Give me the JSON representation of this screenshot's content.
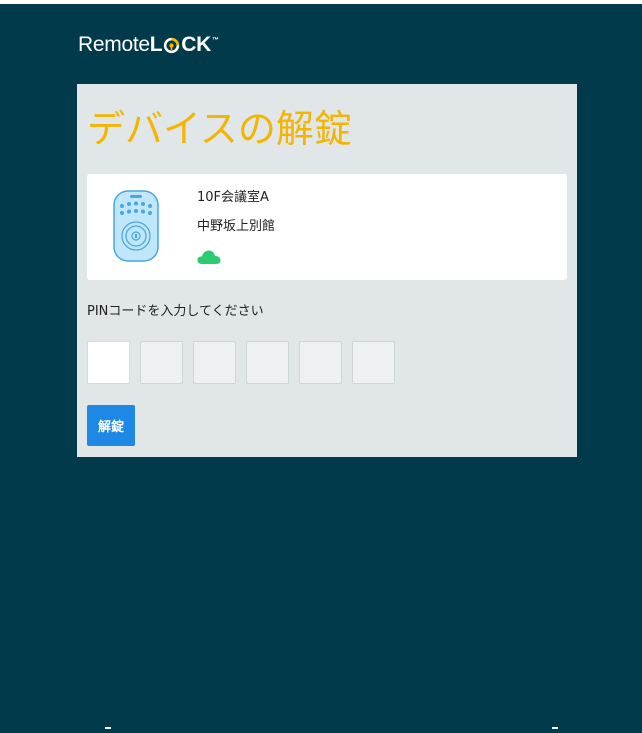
{
  "brand": {
    "name_part1": "Remote",
    "name_part2_l": "L",
    "name_part2_ck": "CK",
    "trademark": "™",
    "accent_color": "#f4b400"
  },
  "page": {
    "title": "デバイスの解錠"
  },
  "device": {
    "name": "10F会議室A",
    "location": "中野坂上別館",
    "status_icon": "cloud-icon",
    "status_color": "#2ecc71"
  },
  "pin": {
    "label": "PINコードを入力してください",
    "digits": [
      "",
      "",
      "",
      "",
      "",
      ""
    ]
  },
  "actions": {
    "unlock_label": "解錠"
  },
  "colors": {
    "background": "#013a4a",
    "card": "#e1e7e8",
    "button": "#1e88e5"
  }
}
